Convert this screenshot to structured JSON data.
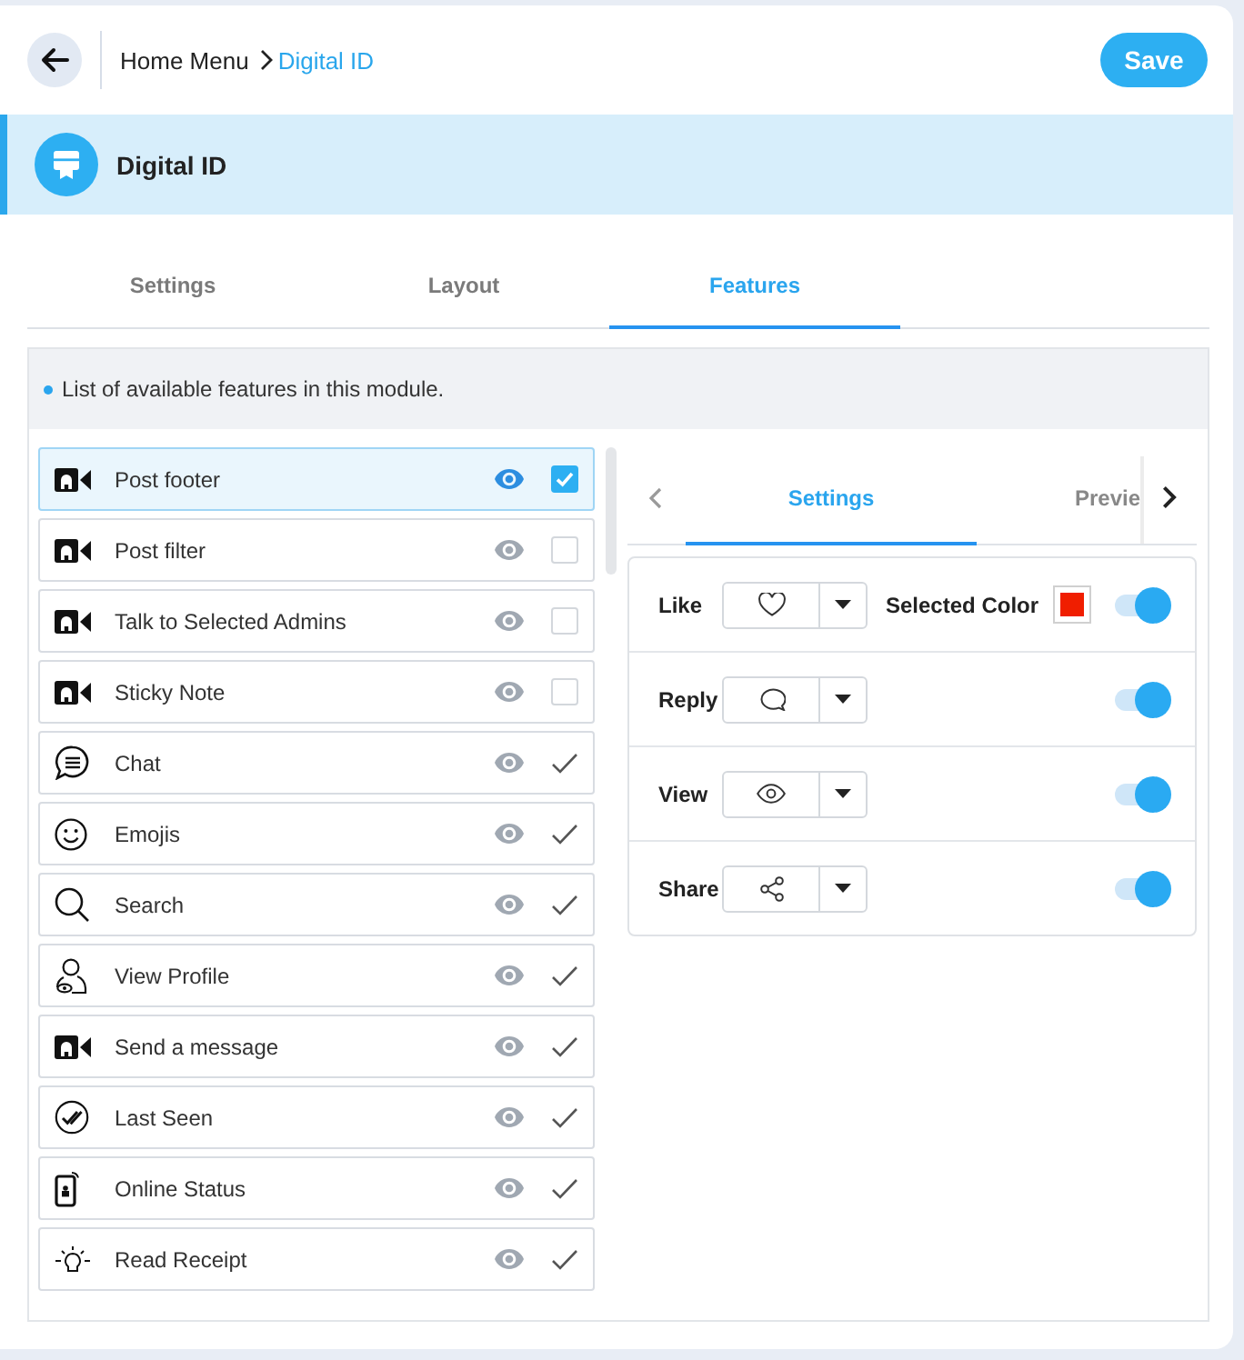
{
  "header": {
    "breadcrumb": [
      {
        "label": "Home Menu",
        "current": false
      },
      {
        "label": "Digital ID",
        "current": true
      }
    ],
    "save_label": "Save"
  },
  "module": {
    "title": "Digital ID"
  },
  "tabs": [
    {
      "label": "Settings",
      "selected": false
    },
    {
      "label": "Layout",
      "selected": false
    },
    {
      "label": "Features",
      "selected": true
    }
  ],
  "features_panel": {
    "note": "List of available features in this module.",
    "features": [
      {
        "label": "Post footer",
        "kind": "checkbox",
        "checked": true,
        "selected": true
      },
      {
        "label": "Post filter",
        "kind": "checkbox",
        "checked": false,
        "selected": false
      },
      {
        "label": "Talk to Selected Admins",
        "kind": "checkbox",
        "checked": false,
        "selected": false
      },
      {
        "label": "Sticky Note",
        "kind": "checkbox",
        "checked": false,
        "selected": false
      },
      {
        "label": "Chat",
        "kind": "tick",
        "checked": true,
        "selected": false
      },
      {
        "label": "Emojis",
        "kind": "tick",
        "checked": true,
        "selected": false
      },
      {
        "label": "Search",
        "kind": "tick",
        "checked": true,
        "selected": false
      },
      {
        "label": "View Profile",
        "kind": "tick",
        "checked": true,
        "selected": false
      },
      {
        "label": "Send a message",
        "kind": "tick",
        "checked": true,
        "selected": false
      },
      {
        "label": "Last Seen",
        "kind": "tick",
        "checked": true,
        "selected": false
      },
      {
        "label": "Online Status",
        "kind": "tick",
        "checked": true,
        "selected": false
      },
      {
        "label": "Read Receipt",
        "kind": "tick",
        "checked": true,
        "selected": false
      }
    ]
  },
  "detail": {
    "tabs": [
      {
        "label": "Settings",
        "selected": true
      },
      {
        "label": "Previe",
        "selected": false
      }
    ],
    "actions": [
      {
        "label": "Like",
        "on": true,
        "selected_color": {
          "label": "Selected Color",
          "color": "#f01e00"
        }
      },
      {
        "label": "Reply",
        "on": true
      },
      {
        "label": "View",
        "on": true
      },
      {
        "label": "Share",
        "on": true
      }
    ]
  }
}
